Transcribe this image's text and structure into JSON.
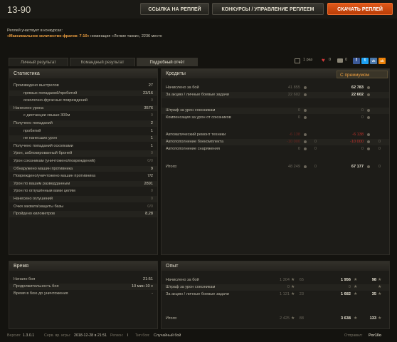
{
  "header": {
    "title": "13-90",
    "buttons": {
      "link": "ССЫЛКА НА РЕПЛЕЙ",
      "contests": "КОНКУРСЫ / УПРАВЛЕНИЕ РЕПЛЕЕМ",
      "download": "СКАЧАТЬ РЕПЛЕЙ"
    }
  },
  "contest": {
    "line1": "Реплей участвует в конкурсах:",
    "bold": "«Максимальное количество фрагов: 7-10»",
    "rest": " номинация «Легкие танки», 2236 место"
  },
  "tabs": [
    "Личный результат",
    "Командный результат",
    "Подробный отчёт"
  ],
  "shares": {
    "views": "1 раз",
    "likes": "0",
    "comments": "0",
    "social": [
      "f",
      "t",
      "vk",
      "ok"
    ]
  },
  "stats": {
    "title": "Статистика",
    "rows": [
      {
        "label": "Произведено выстрелов",
        "value": "27",
        "indent": false
      },
      {
        "label": "прямых попаданий/пробитий",
        "value": "23/16",
        "indent": true
      },
      {
        "label": "осколочно-фугасных повреждений",
        "value": "0",
        "indent": true
      },
      {
        "label": "Нанесено урона",
        "value": "3576",
        "indent": false
      },
      {
        "label": "с дистанции свыше 300м",
        "value": "0",
        "indent": true
      },
      {
        "label": "Получено попаданий",
        "value": "2",
        "indent": false
      },
      {
        "label": "пробитий",
        "value": "1",
        "indent": true
      },
      {
        "label": "не нанесших урон",
        "value": "1",
        "indent": true
      },
      {
        "label": "Получено попаданий осколками",
        "value": "1",
        "indent": false
      },
      {
        "label": "Урон, заблокированный броней",
        "value": "0",
        "indent": false
      },
      {
        "label": "Урон союзникам (уничтожено/повреждений)",
        "value": "0/0",
        "indent": false
      },
      {
        "label": "Обнаружено машин противника",
        "value": "9",
        "indent": false
      },
      {
        "label": "Повреждено/уничтожено машин противника",
        "value": "7/2",
        "indent": false
      },
      {
        "label": "Урон по вашим разведданным",
        "value": "2891",
        "indent": false
      },
      {
        "label": "Урон по оглушённым вами целям",
        "value": "0",
        "indent": false
      },
      {
        "label": "Нанесено оглушений",
        "value": "0",
        "indent": false
      },
      {
        "label": "Очки захвата/защиты базы",
        "value": "0/0",
        "indent": false
      },
      {
        "label": "Пройдено километров",
        "value": "8,28",
        "indent": false
      }
    ]
  },
  "credits": {
    "title": "Кредиты",
    "premium": "С премиумом",
    "rows": [
      {
        "label": "Начислено за бой",
        "base": "41 855",
        "base_extra": "",
        "prem": "62 783",
        "prem_extra": "",
        "red": false
      },
      {
        "label": "За акцию / личные боевые задачи",
        "base": "22 602",
        "base_extra": "",
        "prem": "22 602",
        "prem_extra": "",
        "red": false
      },
      {
        "label": "",
        "base": "",
        "base_extra": "",
        "prem": "",
        "prem_extra": "",
        "red": false
      },
      {
        "label": "Штраф за урон союзникам",
        "base": "0",
        "base_extra": "",
        "prem": "0",
        "prem_extra": "",
        "red": false
      },
      {
        "label": "Компенсация за урон от союзников",
        "base": "0",
        "base_extra": "",
        "prem": "0",
        "prem_extra": "",
        "red": false
      },
      {
        "label": "",
        "base": "",
        "base_extra": "",
        "prem": "",
        "prem_extra": "",
        "red": false
      },
      {
        "label": "Автоматический ремонт техники",
        "base": "-6 138",
        "base_extra": "",
        "prem": "-6 138",
        "prem_extra": "",
        "red": true
      },
      {
        "label": "Автопополнение боекомплекта",
        "base": "-10 000",
        "base_extra": "0",
        "prem": "-10 000",
        "prem_extra": "0",
        "red": true
      },
      {
        "label": "Автопополнение снаряжения",
        "base": "0",
        "base_extra": "0",
        "prem": "0",
        "prem_extra": "0",
        "red": false
      }
    ],
    "total_label": "Итого:",
    "total_base": "48 249",
    "total_base_extra": "0",
    "total_prem": "67 177",
    "total_prem_extra": "0"
  },
  "time": {
    "title": "Время",
    "rows": [
      {
        "label": "Начало боя",
        "value": "21:51"
      },
      {
        "label": "Продолжительность боя",
        "value": "10 мин 10 с"
      },
      {
        "label": "Время в бою до уничтожения",
        "value": "-"
      }
    ]
  },
  "experience": {
    "title": "Опыт",
    "rows": [
      {
        "label": "Начислено за бой",
        "b1": "1 304",
        "b2": "65",
        "p1": "1 956",
        "p2": "98"
      },
      {
        "label": "Штраф за урон союзникам",
        "b1": "0",
        "b2": "",
        "p1": "0",
        "p2": ""
      },
      {
        "label": "За акцию / личные боевые задачи",
        "b1": "1 121",
        "b2": "23",
        "p1": "1 682",
        "p2": "35"
      }
    ],
    "total_label": "Итого:",
    "total": {
      "b1": "2 425",
      "b2": "88",
      "p1": "3 638",
      "p2": "133"
    }
  },
  "footer": {
    "version_label": "Версия:",
    "version": "1.3.0.1",
    "server_time_label": "Серв. вр. игры:",
    "server_time": "2018-12-28 в 21:51",
    "region_label": "Регион:",
    "region": "I",
    "battle_type_label": "Тип боя:",
    "battle_type": "Случайный бой",
    "sender_label": "Отправил:",
    "sender": "Por10o"
  },
  "colors": {
    "accent": "#f0a040",
    "download_button": "#d04e12",
    "negative": "#c0302a",
    "facebook": "#3b5998",
    "twitter": "#1da1f2",
    "vk": "#4a76a8",
    "ok": "#ee8208"
  }
}
